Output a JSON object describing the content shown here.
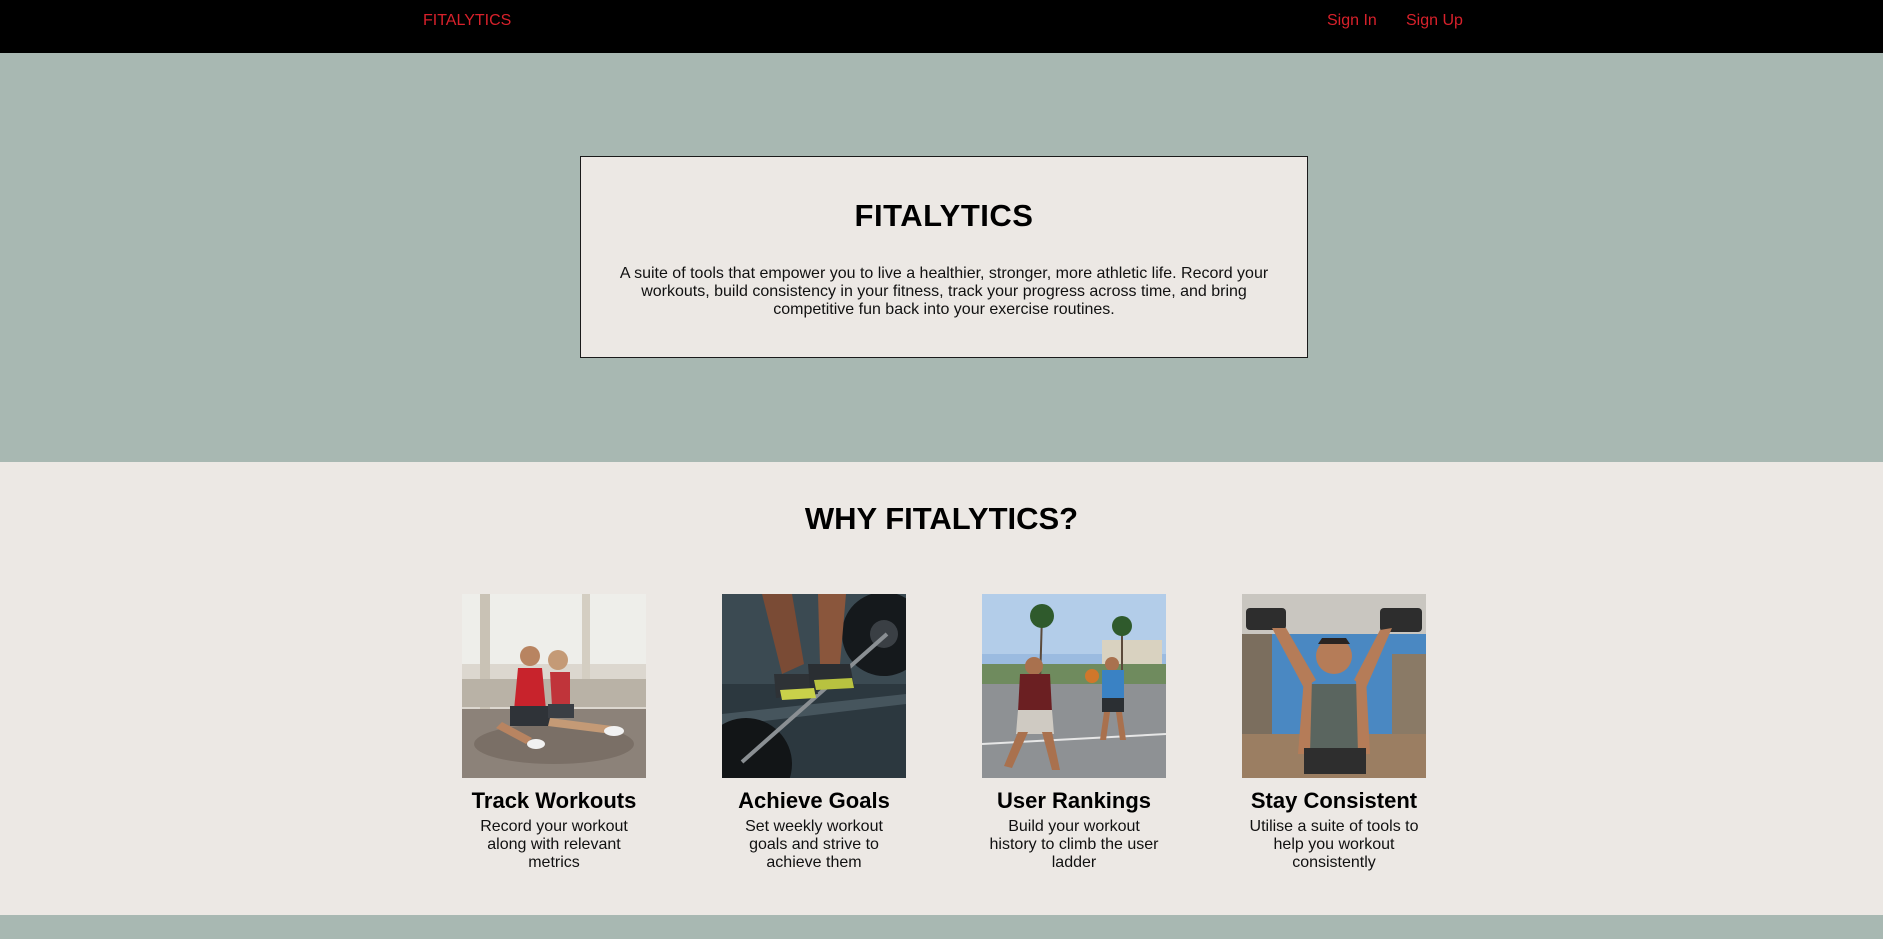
{
  "nav": {
    "brand": "FITALYTICS",
    "sign_in": "Sign In",
    "sign_up": "Sign Up"
  },
  "hero": {
    "title": "FITALYTICS",
    "text": "A suite of tools that empower you to live a healthier, stronger, more athletic life. Record your workouts, build consistency in your fitness, track your progress across time, and bring competitive fun back into your exercise routines."
  },
  "why": {
    "title": "WHY FITALYTICS?",
    "features": [
      {
        "title": "Track Workouts",
        "text": "Record your workout along with relevant metrics",
        "image": "couple-resting-on-gym-floor-photo"
      },
      {
        "title": "Achieve Goals",
        "text": "Set weekly workout goals and strive to achieve them",
        "image": "barbell-deadlift-photo"
      },
      {
        "title": "User Rankings",
        "text": "Build your workout history to climb the user ladder",
        "image": "street-basketball-photo"
      },
      {
        "title": "Stay Consistent",
        "text": "Utilise a suite of tools to help you workout consistently",
        "image": "dumbbell-shoulder-press-photo"
      }
    ]
  },
  "colors": {
    "nav_bg": "#000000",
    "nav_link": "#d8212b",
    "hero_bg": "#a8b8b2",
    "card_bg": "#ece8e4"
  }
}
